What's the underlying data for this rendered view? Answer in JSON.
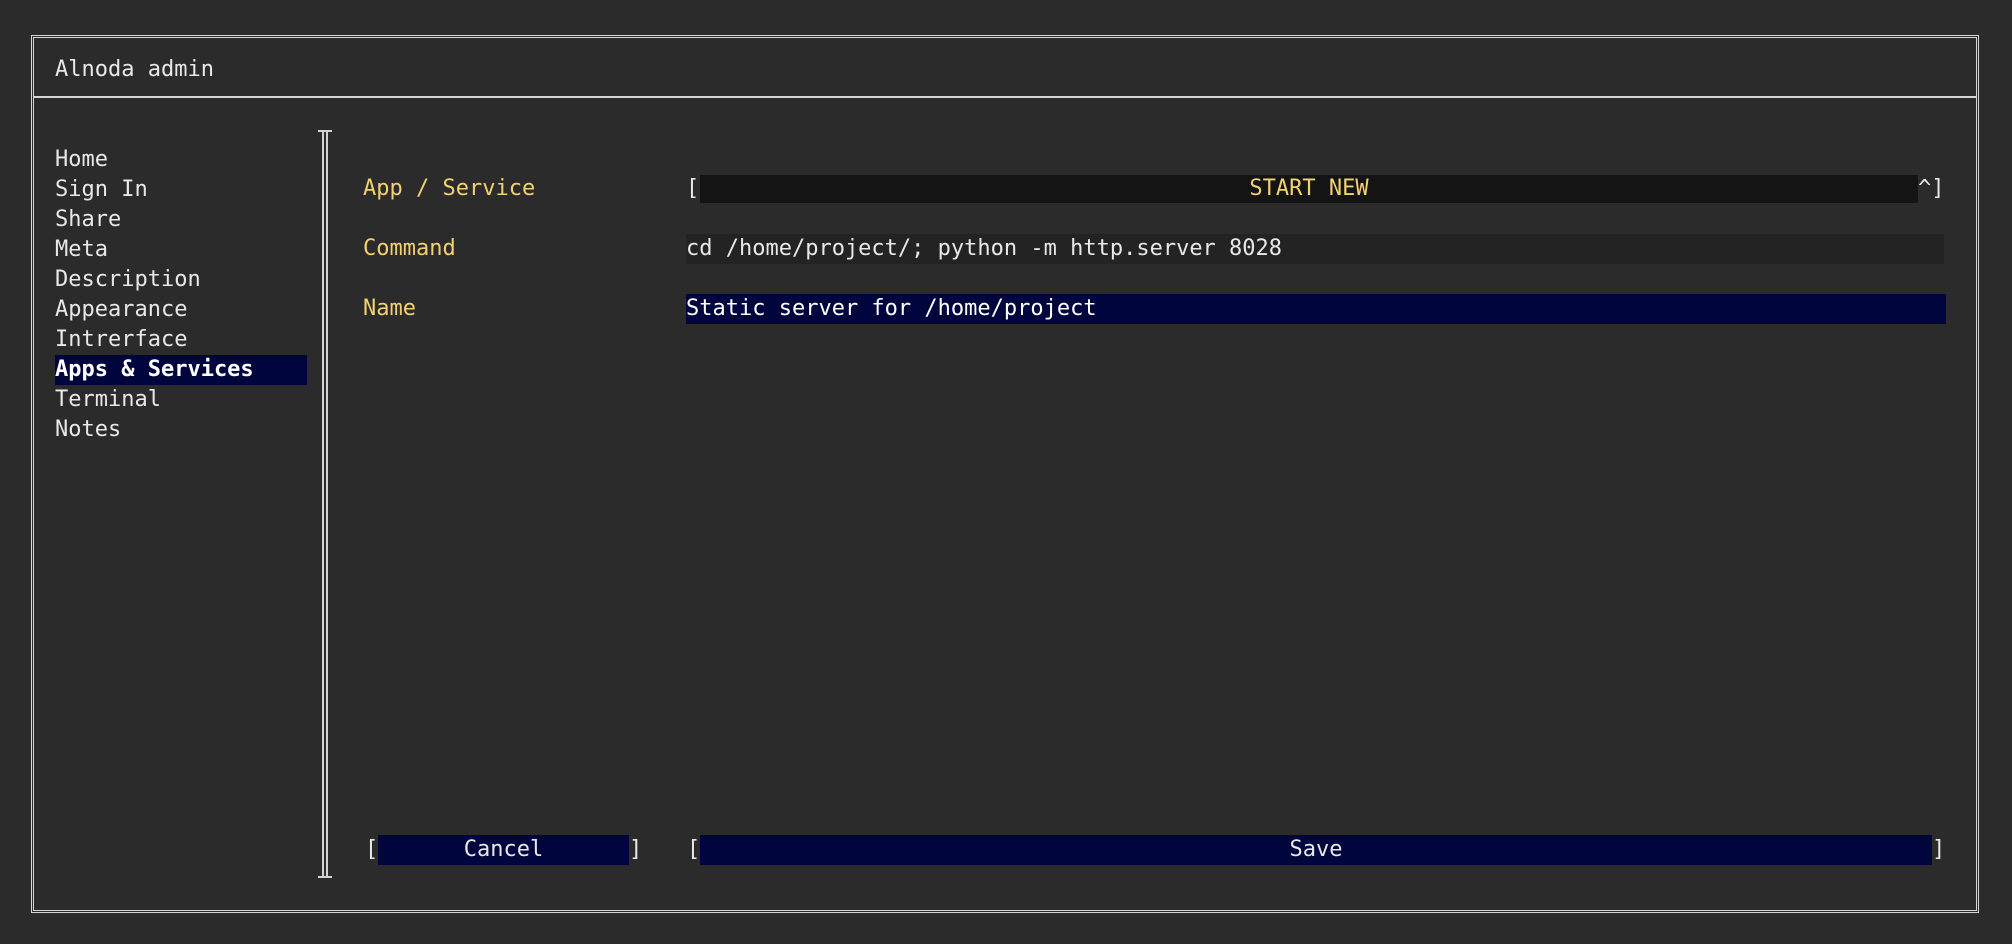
{
  "window": {
    "title": "Alnoda admin"
  },
  "sidebar": {
    "items": [
      {
        "label": "Home"
      },
      {
        "label": "Sign In"
      },
      {
        "label": "Share"
      },
      {
        "label": "Meta"
      },
      {
        "label": "Description"
      },
      {
        "label": "Appearance"
      },
      {
        "label": "Intrerface"
      },
      {
        "label": "Apps & Services",
        "selected": true
      },
      {
        "label": "Terminal"
      },
      {
        "label": "Notes"
      }
    ]
  },
  "form": {
    "app_service": {
      "label": "App / Service",
      "value": "START NEW",
      "open_bracket": "[",
      "close_bracket": "^]"
    },
    "command": {
      "label": "Command",
      "value": "cd /home/project/; python -m http.server 8028"
    },
    "name": {
      "label": "Name",
      "value": "Static server for /home/project"
    }
  },
  "buttons": {
    "cancel_label": "Cancel",
    "save_label": "Save",
    "open_bracket": "[",
    "close_bracket": "]"
  },
  "colors": {
    "background": "#2b2b2b",
    "label_yellow": "#f2d170",
    "selection_navy": "#00063d",
    "border": "#d4d4d4"
  }
}
